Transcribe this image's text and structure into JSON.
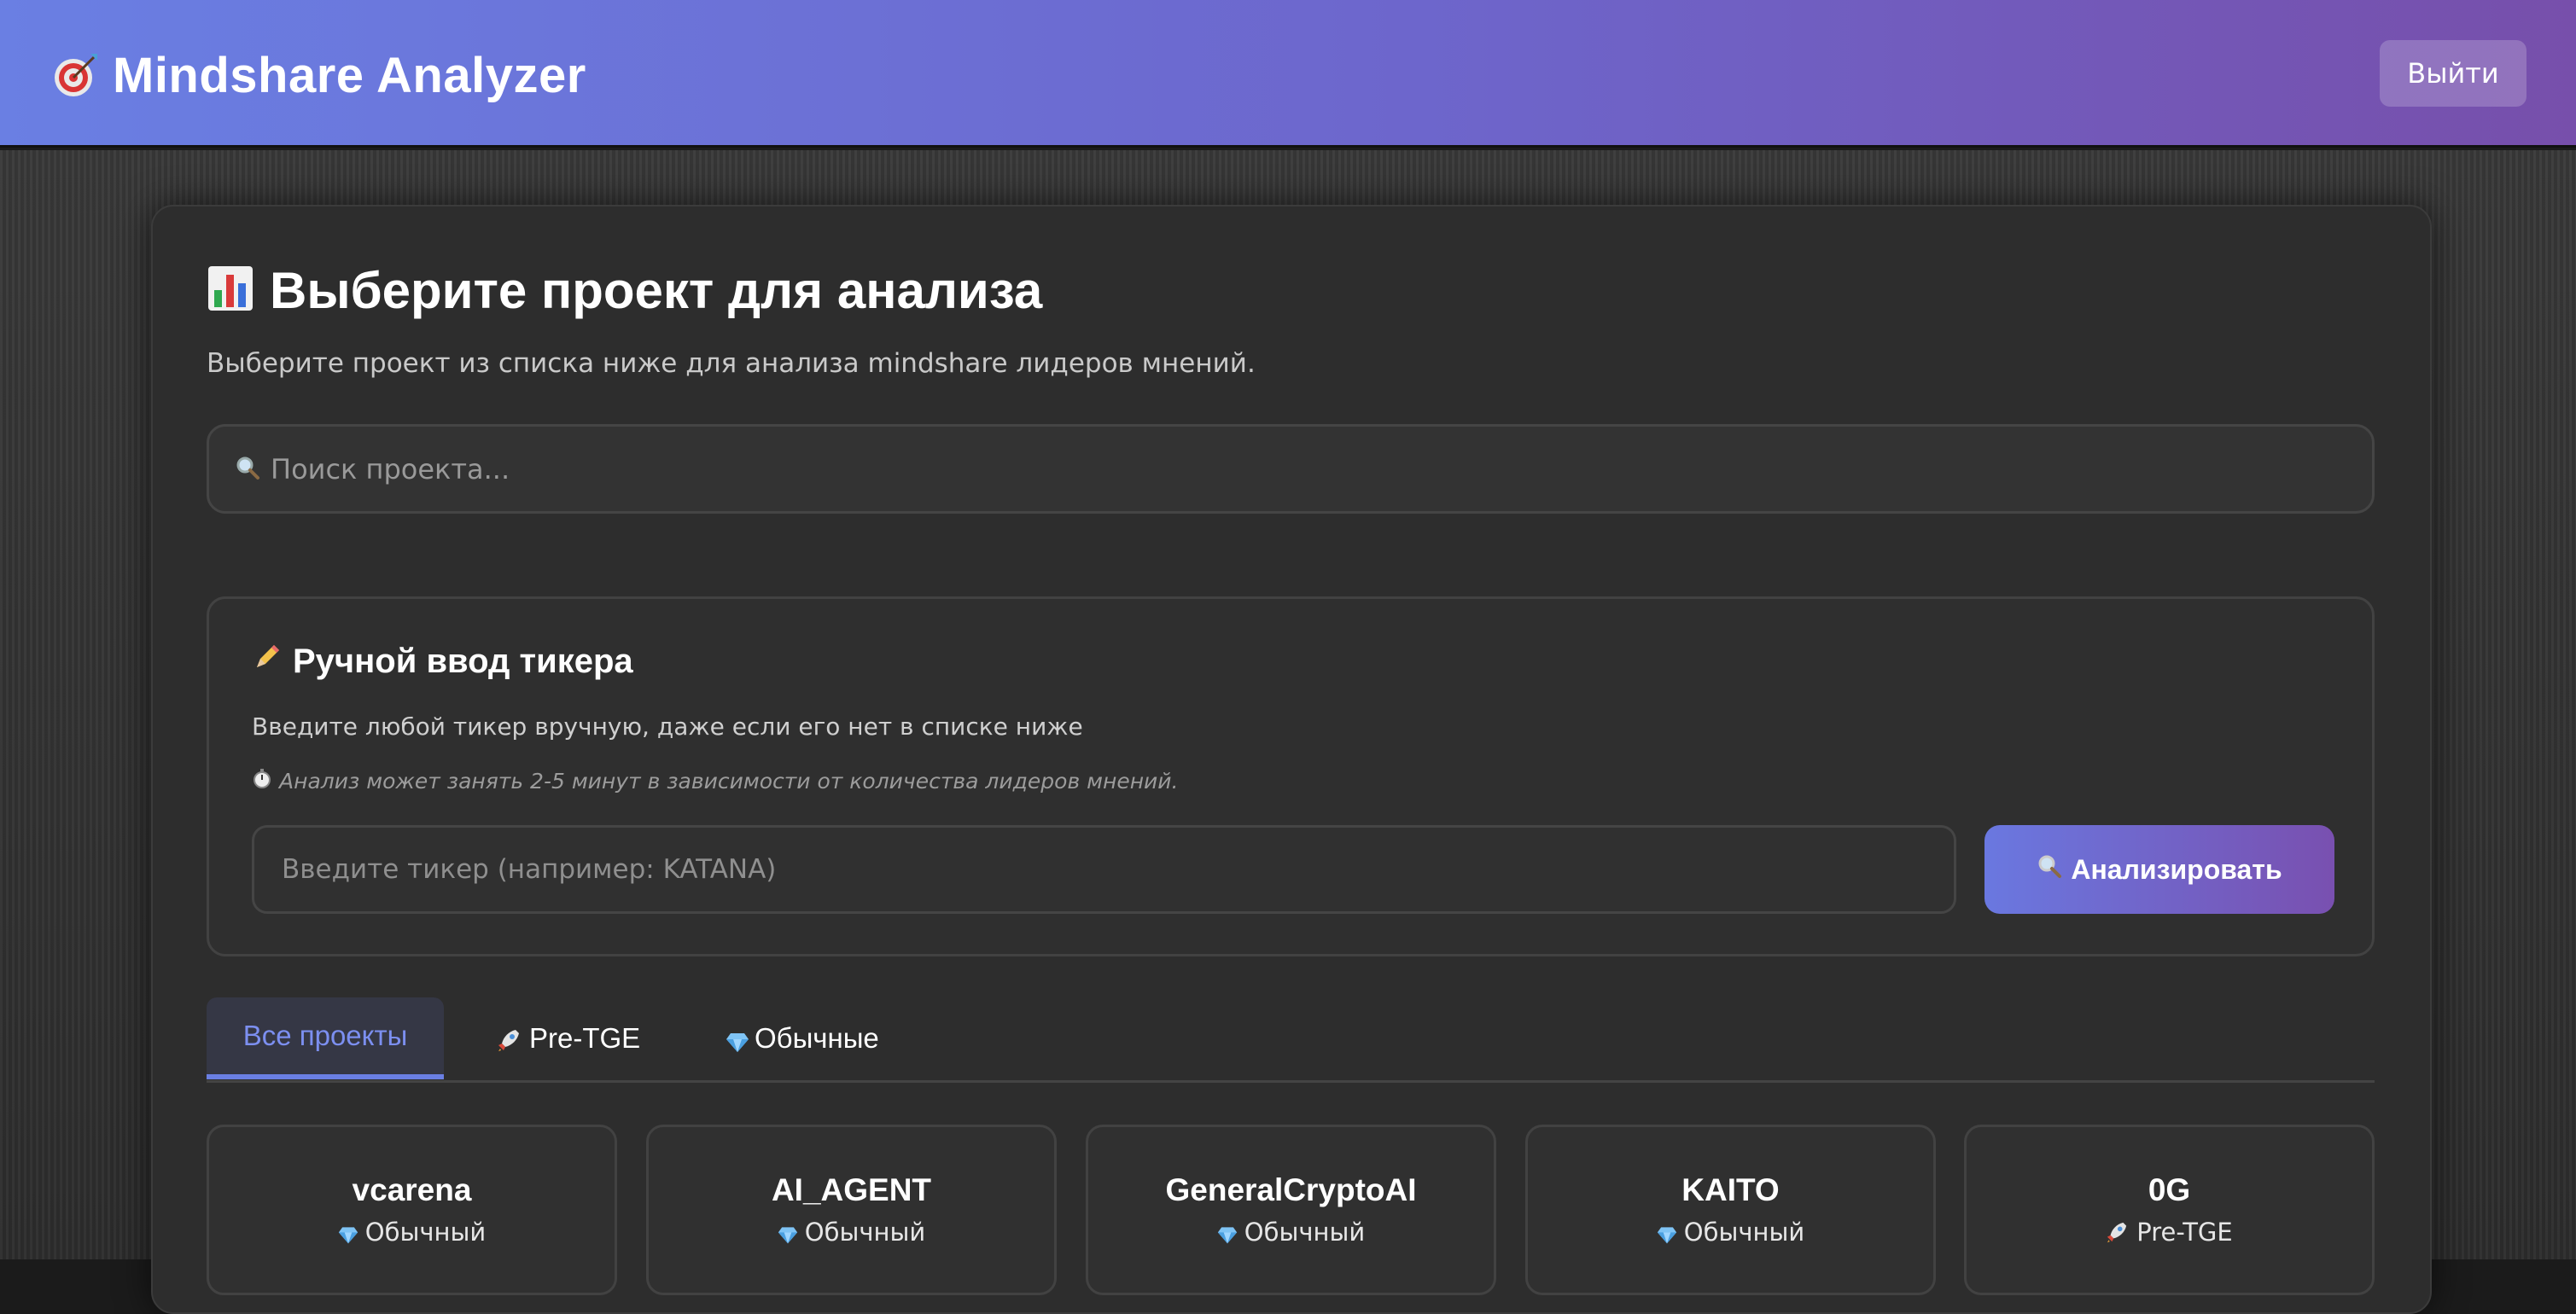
{
  "app": {
    "title": "Mindshare Analyzer",
    "logout_label": "Выйти"
  },
  "main": {
    "heading": "Выберите проект для анализа",
    "subtitle": "Выберите проект из списка ниже для анализа mindshare лидеров мнений.",
    "search": {
      "placeholder": "Поиск проекта..."
    }
  },
  "manual": {
    "title": "Ручной ввод тикера",
    "description": "Введите любой тикер вручную, даже если его нет в списке ниже",
    "note": "Анализ может занять 2-5 минут в зависимости от количества лидеров мнений.",
    "input_placeholder": "Введите тикер (например: KATANA)",
    "button_label": "Анализировать"
  },
  "tabs": [
    {
      "label": "Все проекты",
      "active": true
    },
    {
      "label": "Pre-TGE",
      "icon": "rocket-icon"
    },
    {
      "label": "Обычные",
      "icon": "gem-icon"
    }
  ],
  "projects": [
    {
      "name": "vcarena",
      "type": "Обычный",
      "icon": "gem-icon"
    },
    {
      "name": "AI_AGENT",
      "type": "Обычный",
      "icon": "gem-icon"
    },
    {
      "name": "GeneralCryptoAI",
      "type": "Обычный",
      "icon": "gem-icon"
    },
    {
      "name": "KAITO",
      "type": "Обычный",
      "icon": "gem-icon"
    },
    {
      "name": "0G",
      "type": "Pre-TGE",
      "icon": "rocket-icon"
    }
  ],
  "colors": {
    "header_start": "#6a7fe3",
    "header_end": "#774fab",
    "accent": "#7c8ff0",
    "panel_bg": "#2d2d2d"
  }
}
